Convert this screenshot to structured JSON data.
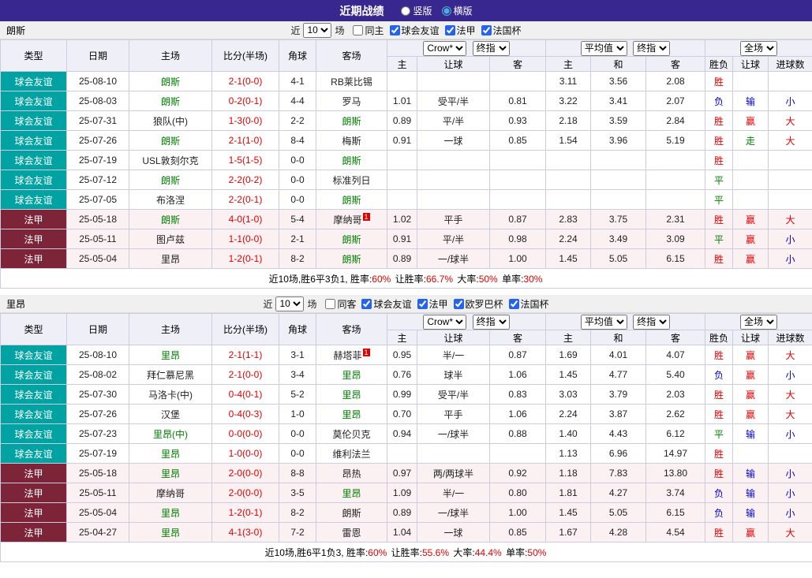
{
  "topbar": {
    "title": "近期战绩",
    "radios": [
      {
        "label": "竖版",
        "checked": false
      },
      {
        "label": "横版",
        "checked": true
      }
    ]
  },
  "colors": {
    "topbar_purple": "#38278F",
    "friendly_league_teal": "#00A2A2",
    "ligue1_maroon": "#7D2438",
    "win_red": "#E00000",
    "draw_green": "#008000",
    "lose_blue": "#0000D0"
  },
  "table_header": {
    "col_type": "类型",
    "col_date": "日期",
    "col_home": "主场",
    "col_score": "比分(半场)",
    "col_corner": "角球",
    "col_away": "客场",
    "odds_select1": "Crow*",
    "odds_select2": "终指",
    "odds_cols": [
      "主",
      "让球",
      "客"
    ],
    "avg_select1": "平均值",
    "avg_select2": "终指",
    "avg_cols": [
      "主",
      "和",
      "客"
    ],
    "result_select": "全场",
    "result_cols": [
      "胜负",
      "让球",
      "进球数"
    ]
  },
  "sections": [
    {
      "team": "朗斯",
      "filter": {
        "near": "近",
        "count": "10",
        "unit": "场",
        "checkboxes": [
          {
            "label": "同主",
            "checked": false
          },
          {
            "label": "球会友谊",
            "checked": true
          },
          {
            "label": "法甲",
            "checked": true
          },
          {
            "label": "法国杯",
            "checked": true
          }
        ]
      },
      "rows": [
        {
          "league": "球会友谊",
          "date": "25-08-10",
          "home": "朗斯",
          "score": "2-1(0-0)",
          "corner": "4-1",
          "away": "RB莱比锡",
          "odds": [
            "",
            "",
            ""
          ],
          "avg": [
            "3.11",
            "3.56",
            "2.08"
          ],
          "outcome": "胜",
          "handicap": "",
          "goals": ""
        },
        {
          "league": "球会友谊",
          "date": "25-08-03",
          "home": "朗斯",
          "score": "0-2(0-1)",
          "corner": "4-4",
          "away": "罗马",
          "odds": [
            "1.01",
            "受平/半",
            "0.81"
          ],
          "avg": [
            "3.22",
            "3.41",
            "2.07"
          ],
          "outcome": "负",
          "handicap": "输",
          "goals": "小"
        },
        {
          "league": "球会友谊",
          "date": "25-07-31",
          "home": "狼队(中)",
          "score": "1-3(0-0)",
          "corner": "2-2",
          "away": "朗斯",
          "odds": [
            "0.89",
            "平/半",
            "0.93"
          ],
          "avg": [
            "2.18",
            "3.59",
            "2.84"
          ],
          "outcome": "胜",
          "handicap": "赢",
          "goals": "大"
        },
        {
          "league": "球会友谊",
          "date": "25-07-26",
          "home": "朗斯",
          "score": "2-1(1-0)",
          "corner": "8-4",
          "away": "梅斯",
          "odds": [
            "0.91",
            "一球",
            "0.85"
          ],
          "avg": [
            "1.54",
            "3.96",
            "5.19"
          ],
          "outcome": "胜",
          "handicap": "走",
          "goals": "大"
        },
        {
          "league": "球会友谊",
          "date": "25-07-19",
          "home": "USL敦刻尔克",
          "score": "1-5(1-5)",
          "corner": "0-0",
          "away": "朗斯",
          "odds": [
            "",
            "",
            ""
          ],
          "avg": [
            "",
            "",
            ""
          ],
          "outcome": "胜",
          "handicap": "",
          "goals": ""
        },
        {
          "league": "球会友谊",
          "date": "25-07-12",
          "home": "朗斯",
          "score": "2-2(0-2)",
          "corner": "0-0",
          "away": "标准列日",
          "odds": [
            "",
            "",
            ""
          ],
          "avg": [
            "",
            "",
            ""
          ],
          "outcome": "平",
          "handicap": "",
          "goals": ""
        },
        {
          "league": "球会友谊",
          "date": "25-07-05",
          "home": "布洛涅",
          "score": "2-2(0-1)",
          "corner": "0-0",
          "away": "朗斯",
          "odds": [
            "",
            "",
            ""
          ],
          "avg": [
            "",
            "",
            ""
          ],
          "outcome": "平",
          "handicap": "",
          "goals": ""
        },
        {
          "league": "法甲",
          "date": "25-05-18",
          "home": "朗斯",
          "score": "4-0(1-0)",
          "corner": "5-4",
          "away": "摩纳哥",
          "away_sup": "1",
          "odds": [
            "1.02",
            "平手",
            "0.87"
          ],
          "avg": [
            "2.83",
            "3.75",
            "2.31"
          ],
          "outcome": "胜",
          "handicap": "赢",
          "goals": "大"
        },
        {
          "league": "法甲",
          "date": "25-05-11",
          "home": "图卢兹",
          "score": "1-1(0-0)",
          "corner": "2-1",
          "away": "朗斯",
          "odds": [
            "0.91",
            "平/半",
            "0.98"
          ],
          "avg": [
            "2.24",
            "3.49",
            "3.09"
          ],
          "outcome": "平",
          "handicap": "赢",
          "goals": "小"
        },
        {
          "league": "法甲",
          "date": "25-05-04",
          "home": "里昂",
          "score": "1-2(0-1)",
          "corner": "8-2",
          "away": "朗斯",
          "odds": [
            "0.89",
            "一/球半",
            "1.00"
          ],
          "avg": [
            "1.45",
            "5.05",
            "6.15"
          ],
          "outcome": "胜",
          "handicap": "赢",
          "goals": "小"
        }
      ],
      "summary": {
        "prefix": "近10场,胜6平3负1,",
        "stats": [
          {
            "label": "胜率:",
            "value": "60%"
          },
          {
            "label": "让胜率:",
            "value": "66.7%"
          },
          {
            "label": "大率:",
            "value": "50%"
          },
          {
            "label": "单率:",
            "value": "30%"
          }
        ]
      }
    },
    {
      "team": "里昂",
      "filter": {
        "near": "近",
        "count": "10",
        "unit": "场",
        "checkboxes": [
          {
            "label": "同客",
            "checked": false
          },
          {
            "label": "球会友谊",
            "checked": true
          },
          {
            "label": "法甲",
            "checked": true
          },
          {
            "label": "欧罗巴杯",
            "checked": true
          },
          {
            "label": "法国杯",
            "checked": true
          }
        ]
      },
      "rows": [
        {
          "league": "球会友谊",
          "date": "25-08-10",
          "home": "里昂",
          "score": "2-1(1-1)",
          "corner": "3-1",
          "away": "赫塔菲",
          "away_sup": "1",
          "odds": [
            "0.95",
            "半/一",
            "0.87"
          ],
          "avg": [
            "1.69",
            "4.01",
            "4.07"
          ],
          "outcome": "胜",
          "handicap": "赢",
          "goals": "大"
        },
        {
          "league": "球会友谊",
          "date": "25-08-02",
          "home": "拜仁慕尼黑",
          "score": "2-1(0-0)",
          "corner": "3-4",
          "away": "里昂",
          "odds": [
            "0.76",
            "球半",
            "1.06"
          ],
          "avg": [
            "1.45",
            "4.77",
            "5.40"
          ],
          "outcome": "负",
          "handicap": "赢",
          "goals": "小"
        },
        {
          "league": "球会友谊",
          "date": "25-07-30",
          "home": "马洛卡(中)",
          "score": "0-4(0-1)",
          "corner": "5-2",
          "away": "里昂",
          "odds": [
            "0.99",
            "受平/半",
            "0.83"
          ],
          "avg": [
            "3.03",
            "3.79",
            "2.03"
          ],
          "outcome": "胜",
          "handicap": "赢",
          "goals": "大"
        },
        {
          "league": "球会友谊",
          "date": "25-07-26",
          "home": "汉堡",
          "score": "0-4(0-3)",
          "corner": "1-0",
          "away": "里昂",
          "odds": [
            "0.70",
            "平手",
            "1.06"
          ],
          "avg": [
            "2.24",
            "3.87",
            "2.62"
          ],
          "outcome": "胜",
          "handicap": "赢",
          "goals": "大"
        },
        {
          "league": "球会友谊",
          "date": "25-07-23",
          "home": "里昂(中)",
          "score": "0-0(0-0)",
          "corner": "0-0",
          "away": "莫伦贝克",
          "odds": [
            "0.94",
            "一/球半",
            "0.88"
          ],
          "avg": [
            "1.40",
            "4.43",
            "6.12"
          ],
          "outcome": "平",
          "handicap": "输",
          "goals": "小"
        },
        {
          "league": "球会友谊",
          "date": "25-07-19",
          "home": "里昂",
          "score": "1-0(0-0)",
          "corner": "0-0",
          "away": "维利法兰",
          "odds": [
            "",
            "",
            ""
          ],
          "avg": [
            "1.13",
            "6.96",
            "14.97"
          ],
          "outcome": "胜",
          "handicap": "",
          "goals": ""
        },
        {
          "league": "法甲",
          "date": "25-05-18",
          "home": "里昂",
          "score": "2-0(0-0)",
          "corner": "8-8",
          "away": "昂热",
          "odds": [
            "0.97",
            "两/两球半",
            "0.92"
          ],
          "avg": [
            "1.18",
            "7.83",
            "13.80"
          ],
          "outcome": "胜",
          "handicap": "输",
          "goals": "小"
        },
        {
          "league": "法甲",
          "date": "25-05-11",
          "home": "摩纳哥",
          "score": "2-0(0-0)",
          "corner": "3-5",
          "away": "里昂",
          "odds": [
            "1.09",
            "半/一",
            "0.80"
          ],
          "avg": [
            "1.81",
            "4.27",
            "3.74"
          ],
          "outcome": "负",
          "handicap": "输",
          "goals": "小"
        },
        {
          "league": "法甲",
          "date": "25-05-04",
          "home": "里昂",
          "score": "1-2(0-1)",
          "corner": "8-2",
          "away": "朗斯",
          "odds": [
            "0.89",
            "一/球半",
            "1.00"
          ],
          "avg": [
            "1.45",
            "5.05",
            "6.15"
          ],
          "outcome": "负",
          "handicap": "输",
          "goals": "小"
        },
        {
          "league": "法甲",
          "date": "25-04-27",
          "home": "里昂",
          "score": "4-1(3-0)",
          "corner": "7-2",
          "away": "雷恩",
          "odds": [
            "1.04",
            "一球",
            "0.85"
          ],
          "avg": [
            "1.67",
            "4.28",
            "4.54"
          ],
          "outcome": "胜",
          "handicap": "赢",
          "goals": "大"
        }
      ],
      "summary": {
        "prefix": "近10场,胜6平1负3,",
        "stats": [
          {
            "label": "胜率:",
            "value": "60%"
          },
          {
            "label": "让胜率:",
            "value": "55.6%"
          },
          {
            "label": "大率:",
            "value": "44.4%"
          },
          {
            "label": "单率:",
            "value": "50%"
          }
        ]
      }
    }
  ]
}
